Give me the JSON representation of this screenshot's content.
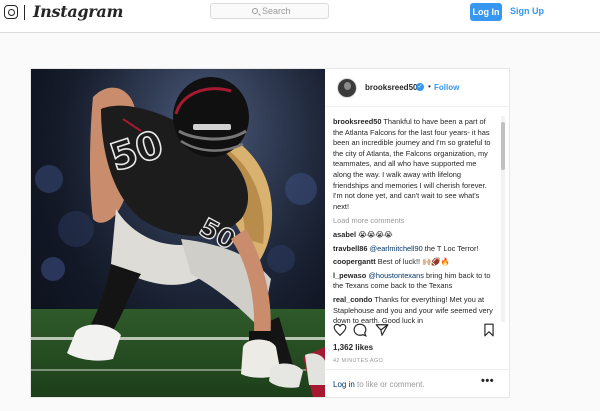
{
  "header": {
    "brand": "Instagram",
    "search_placeholder": "Search",
    "login_label": "Log In",
    "signup_label": "Sign Up",
    "icons": [
      "instagram-camera-icon",
      "search-icon"
    ]
  },
  "post": {
    "username": "brooksreed50",
    "follow_label": "Follow",
    "separator": "•",
    "caption_user": "brooksreed50",
    "caption": "Thankful to have been a part of the Atlanta Falcons for the last four years- it has been an incredible journey and I'm so grateful to the city of Atlanta, the Falcons organization, my teammates, and all who have supported me along the way. I walk away with lifelong friendships and memories I will cherish forever. I'm not done yet, and can't wait to see what's next!",
    "load_more": "Load more comments",
    "comments": [
      {
        "user": "asabel",
        "text": "😭😭😭😭"
      },
      {
        "user": "travbell86",
        "mention": "@earlmitchell90",
        "text": " the T Loc Terror!"
      },
      {
        "user": "coopergantt",
        "text": "Best of luck!! 🙌🏼🏈🔥"
      },
      {
        "user": "l_pewaso",
        "mention": "@houstontexans",
        "text": " bring him back to to the Texans come back to the Texans"
      },
      {
        "user": "real_condo",
        "text": "Thanks for everything! Met you at Staplehouse and you and your wife seemed very down to earth. Good luck in"
      }
    ],
    "likes": "1,362 likes",
    "time_ago": "42 MINUTES AGO",
    "login_link": "Log in",
    "login_suffix": " to like or comment.",
    "more_options": "•••",
    "icons": [
      "heart-icon",
      "comment-icon",
      "share-icon",
      "bookmark-icon",
      "verified-badge-icon"
    ],
    "photo_jersey_number": "50"
  },
  "colors": {
    "accent": "#3897f0",
    "link": "#003569",
    "falcons_red": "#a71930",
    "jersey_black": "#1c1c1c"
  }
}
